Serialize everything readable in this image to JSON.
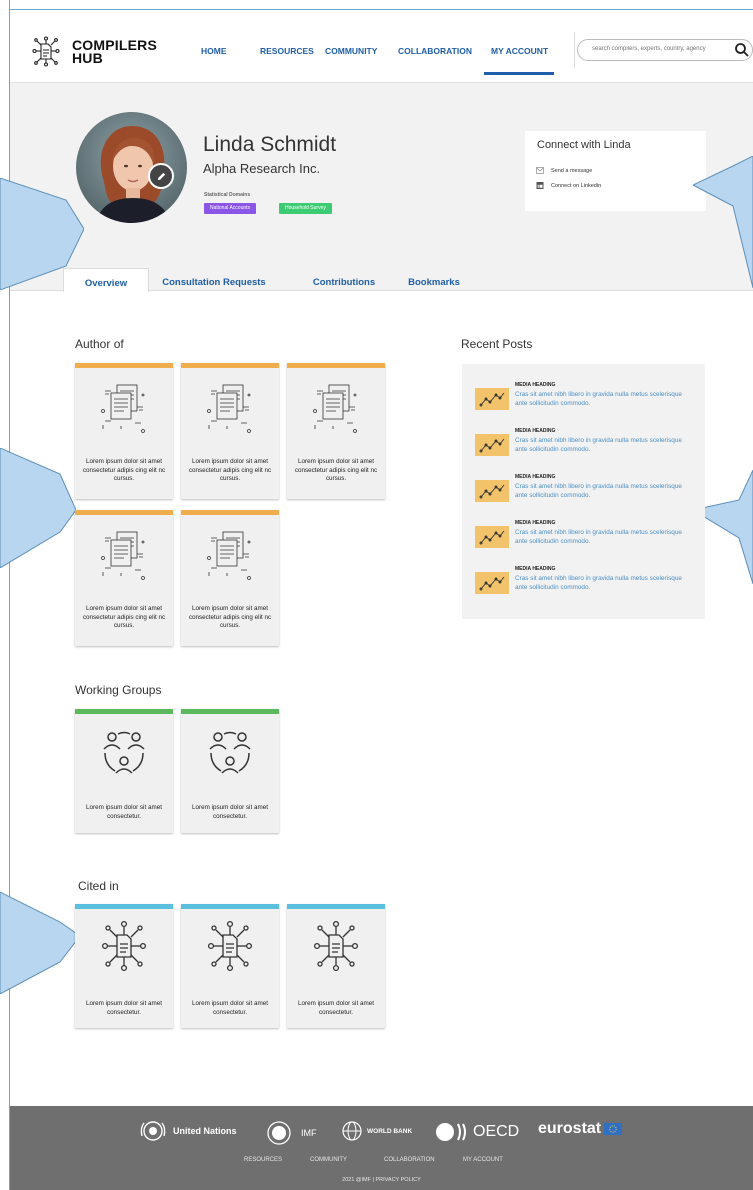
{
  "brand": {
    "line1": "COMPILERS",
    "line2": "HUB"
  },
  "nav": {
    "items": [
      "HOME",
      "RESOURCES",
      "COMMUNITY",
      "COLLABORATION",
      "MY ACCOUNT"
    ],
    "active": "MY ACCOUNT"
  },
  "search": {
    "placeholder": "search compilers, experts, country, agency"
  },
  "profile": {
    "name": "Linda Schmidt",
    "organization": "Alpha Research Inc.",
    "domains_label": "Statistical Domains",
    "tags": [
      {
        "label": "National Accounts",
        "color": "#8b55e6"
      },
      {
        "label": "Household Survey",
        "color": "#3dcc74"
      }
    ]
  },
  "connect": {
    "title": "Connect with Linda",
    "send_message": "Send a message",
    "linkedin": "Connect on Linkedin"
  },
  "tabs": [
    "Overview",
    "Consultation Requests",
    "Contributions",
    "Bookmarks"
  ],
  "author_of": {
    "title": "Author of",
    "accent": "#f0ad4e",
    "cards": [
      "Lorem ipsum dolor sit amet consectetur adipis cing elit nc cursus.",
      "Lorem ipsum dolor sit amet consectetur adipis cing elit nc cursus.",
      "Lorem ipsum dolor sit amet consectetur adipis cing elit nc cursus.",
      "Lorem ipsum dolor sit amet consectetur adipis cing elit nc cursus.",
      "Lorem ipsum dolor sit amet consectetur adipis cing elit nc cursus."
    ]
  },
  "working_groups": {
    "title": "Working Groups",
    "accent": "#5cb85c",
    "cards": [
      "Lorem ipsum dolor sit amet consectetur.",
      "Lorem ipsum dolor sit amet consectetur."
    ]
  },
  "cited_in": {
    "title": "Cited in",
    "accent": "#5bc0de",
    "cards": [
      "Lorem ipsum dolor sit amet consectetur.",
      "Lorem ipsum dolor sit amet consectetur.",
      "Lorem ipsum dolor sit amet consectetur."
    ]
  },
  "recent_posts": {
    "title": "Recent Posts",
    "posts": [
      {
        "heading": "MEDIA HEADING",
        "body": "Cras sit amet nibh libero in gravida nulla metus scelerisque ante sollicitudin commodo."
      },
      {
        "heading": "MEDIA HEADING",
        "body": "Cras sit amet nibh libero in gravida nulla metus scelerisque ante sollicitudin commodo."
      },
      {
        "heading": "MEDIA HEADING",
        "body": "Cras sit amet nibh libero in gravida nulla metus scelerisque ante sollicitudin commodo."
      },
      {
        "heading": "MEDIA HEADING",
        "body": "Cras sit amet nibh libero in gravida nulla metus scelerisque ante sollicitudin commodo."
      },
      {
        "heading": "MEDIA HEADING",
        "body": "Cras sit amet nibh libero in gravida nulla metus scelerisque ante sollicitudin commodo."
      }
    ]
  },
  "footer": {
    "partners": [
      "United Nations",
      "IMF",
      "WORLD BANK",
      "OECD",
      "eurostat"
    ],
    "links": [
      "RESOURCES",
      "COMMUNITY",
      "COLLABORATION",
      "MY ACCOUNT"
    ],
    "copyright": "2021 @IMF  |  PRIVACY POLICY"
  },
  "colors": {
    "nav_blue": "#1f5ea8",
    "callout_blue": "#b8d6ef",
    "footer_gray": "#6f6f6f"
  }
}
